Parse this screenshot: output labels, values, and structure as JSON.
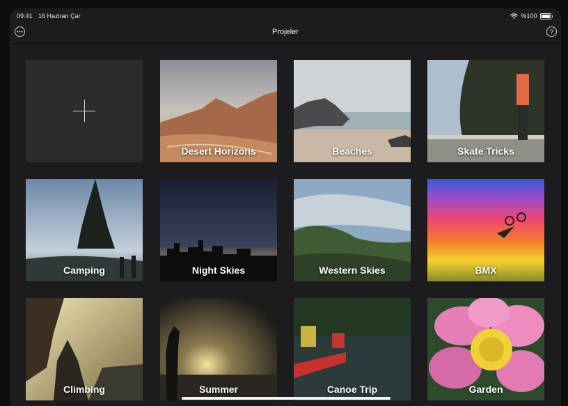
{
  "status": {
    "time": "09:41",
    "date": "16 Haziran Çar",
    "battery": "%100"
  },
  "nav": {
    "title": "Projeler",
    "more_icon": "ellipsis-circle-icon",
    "help_label": "?"
  },
  "projects": [
    {
      "label": ""
    },
    {
      "label": "Desert Horizons"
    },
    {
      "label": "Beaches"
    },
    {
      "label": "Skate Tricks"
    },
    {
      "label": "Camping"
    },
    {
      "label": "Night Skies"
    },
    {
      "label": "Western Skies"
    },
    {
      "label": "BMX"
    },
    {
      "label": "Climbing"
    },
    {
      "label": "Summer"
    },
    {
      "label": "Canoe Trip"
    },
    {
      "label": "Garden"
    }
  ]
}
